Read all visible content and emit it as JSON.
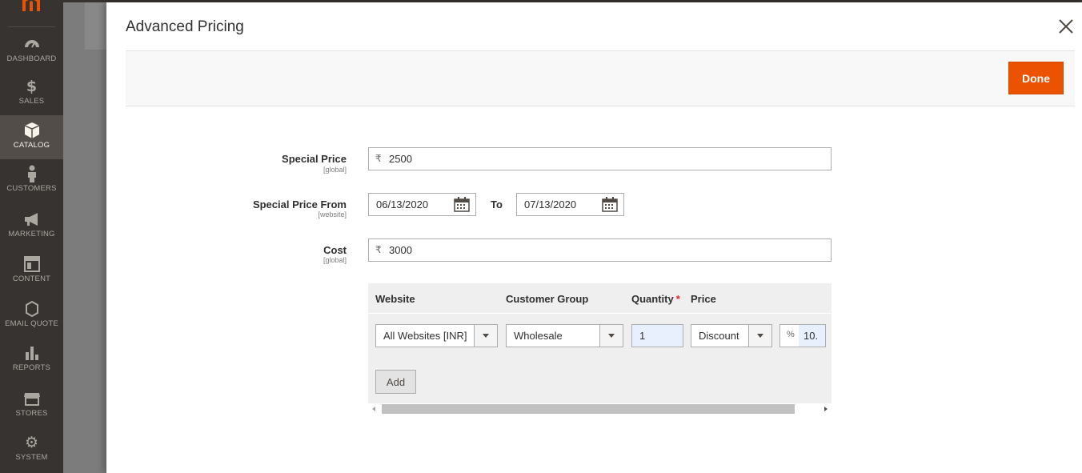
{
  "nav": {
    "items": [
      {
        "label": "DASHBOARD",
        "icon": "dashboard-gauge-icon"
      },
      {
        "label": "SALES",
        "icon": "dollar-icon"
      },
      {
        "label": "CATALOG",
        "icon": "box-icon",
        "active": true
      },
      {
        "label": "CUSTOMERS",
        "icon": "person-icon"
      },
      {
        "label": "MARKETING",
        "icon": "megaphone-icon"
      },
      {
        "label": "CONTENT",
        "icon": "layout-icon"
      },
      {
        "label": "EMAIL QUOTE",
        "icon": "hexagon-icon"
      },
      {
        "label": "REPORTS",
        "icon": "bar-chart-icon"
      },
      {
        "label": "STORES",
        "icon": "storefront-icon"
      },
      {
        "label": "SYSTEM",
        "icon": "gear-icon"
      }
    ]
  },
  "modal": {
    "title": "Advanced Pricing",
    "done_label": "Done"
  },
  "form": {
    "special_price": {
      "label": "Special Price",
      "scope": "[global]",
      "currency": "₹",
      "value": "2500"
    },
    "special_price_from": {
      "label": "Special Price From",
      "scope": "[website]",
      "from_value": "06/13/2020",
      "to_label": "To",
      "to_value": "07/13/2020"
    },
    "cost": {
      "label": "Cost",
      "scope": "[global]",
      "currency": "₹",
      "value": "3000"
    }
  },
  "tier_price": {
    "headers": {
      "website": "Website",
      "customer_group": "Customer Group",
      "quantity": "Quantity",
      "quantity_required": "*",
      "price": "Price"
    },
    "rows": [
      {
        "website": "All Websites [INR]",
        "customer_group": "Wholesale",
        "quantity": "1",
        "price_type": "Discount",
        "percent_symbol": "%",
        "price_value": "10."
      }
    ],
    "add_label": "Add"
  },
  "colors": {
    "accent": "#eb5202",
    "nav_bg": "#373330",
    "nav_active": "#524d49"
  }
}
